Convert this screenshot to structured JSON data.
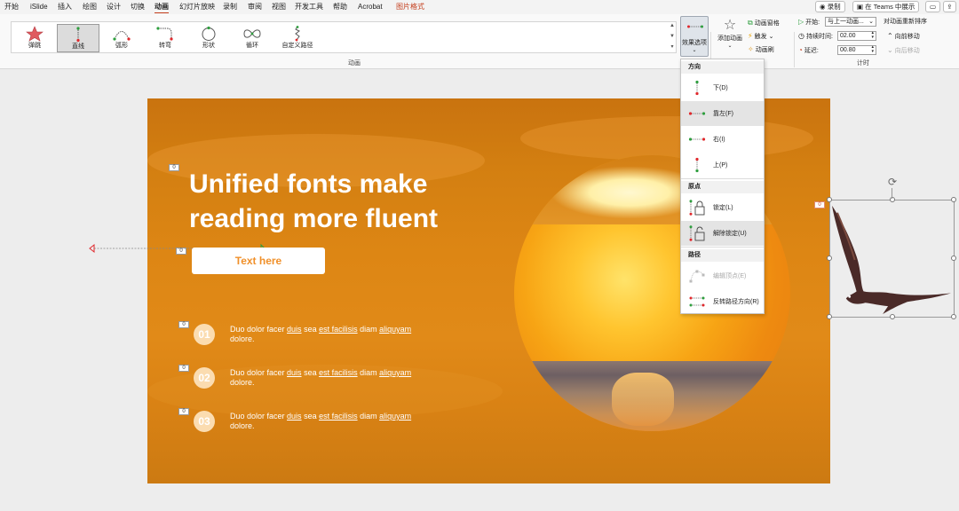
{
  "menu": {
    "tabs": [
      "开始",
      "iSlide",
      "插入",
      "绘图",
      "设计",
      "切换",
      "动画",
      "幻灯片放映",
      "录制",
      "审阅",
      "视图",
      "开发工具",
      "帮助",
      "Acrobat",
      "图片格式"
    ],
    "active_tab": "动画",
    "record_button": "录制",
    "teams_button": "在 Teams 中展示"
  },
  "ribbon": {
    "animations": [
      {
        "label": "弹跳",
        "icon": "bounce-star-icon"
      },
      {
        "label": "直线",
        "icon": "line-path-icon"
      },
      {
        "label": "弧形",
        "icon": "arc-path-icon"
      },
      {
        "label": "转弯",
        "icon": "turn-path-icon"
      },
      {
        "label": "形状",
        "icon": "circle-path-icon"
      },
      {
        "label": "循环",
        "icon": "loop-path-icon"
      },
      {
        "label": "自定义路径",
        "icon": "custom-path-icon"
      }
    ],
    "selected_animation": "直线",
    "group_label_animation": "动画",
    "effect_options": "效果选项",
    "add_animation": "添加动画",
    "animation_pane": "动画窗格",
    "trigger": "触发",
    "animation_painter": "动画刷",
    "start_label": "开始:",
    "start_value": "与上一动画...",
    "duration_label": "持续时间:",
    "duration_value": "02.00",
    "delay_label": "延迟:",
    "delay_value": "00.80",
    "reorder_title": "对动画重新排序",
    "move_earlier": "向前移动",
    "move_later": "向后移动",
    "group_label_timing": "计时"
  },
  "slide": {
    "title_line1": "Unified fonts make",
    "title_line2": "reading more fluent",
    "pill_text": "Text here",
    "tag": "0",
    "bird_tag": "0",
    "items": [
      {
        "num": "01",
        "line1_a": "Duo dolor facer ",
        "line1_b": "duis",
        "line1_c": " sea ",
        "line1_d": "est facilisis",
        "line1_e": " diam ",
        "line1_f": "aliquyam",
        "line2": "dolore."
      },
      {
        "num": "02",
        "line1_a": "Duo dolor facer ",
        "line1_b": "duis",
        "line1_c": " sea ",
        "line1_d": "est facilisis",
        "line1_e": " diam ",
        "line1_f": "aliquyam",
        "line2": "dolore."
      },
      {
        "num": "03",
        "line1_a": "Duo dolor facer ",
        "line1_b": "duis",
        "line1_c": " sea ",
        "line1_d": "est facilisis",
        "line1_e": " diam ",
        "line1_f": "aliquyam",
        "line2": "dolore."
      }
    ]
  },
  "dropdown": {
    "direction_header": "方向",
    "directions": [
      {
        "label": "下(D)",
        "icon": "arrow-down-path-icon"
      },
      {
        "label": "靠左(F)",
        "icon": "arrow-left-path-icon"
      },
      {
        "label": "右(I)",
        "icon": "arrow-right-path-icon"
      },
      {
        "label": "上(P)",
        "icon": "arrow-up-path-icon"
      }
    ],
    "origin_header": "原点",
    "origins": [
      {
        "label": "锁定(L)",
        "icon": "lock-icon"
      },
      {
        "label": "解除锁定(U)",
        "icon": "unlock-icon"
      }
    ],
    "path_header": "路径",
    "paths": [
      {
        "label": "编辑顶点(E)",
        "icon": "edit-points-icon"
      },
      {
        "label": "反转路径方向(R)",
        "icon": "reverse-path-icon"
      }
    ]
  },
  "colors": {
    "accent": "#c43e1c",
    "slide_orange": "#dd8614",
    "pill_text": "#f0902a",
    "path_green": "#2e9e3e",
    "path_red": "#e0282c"
  }
}
